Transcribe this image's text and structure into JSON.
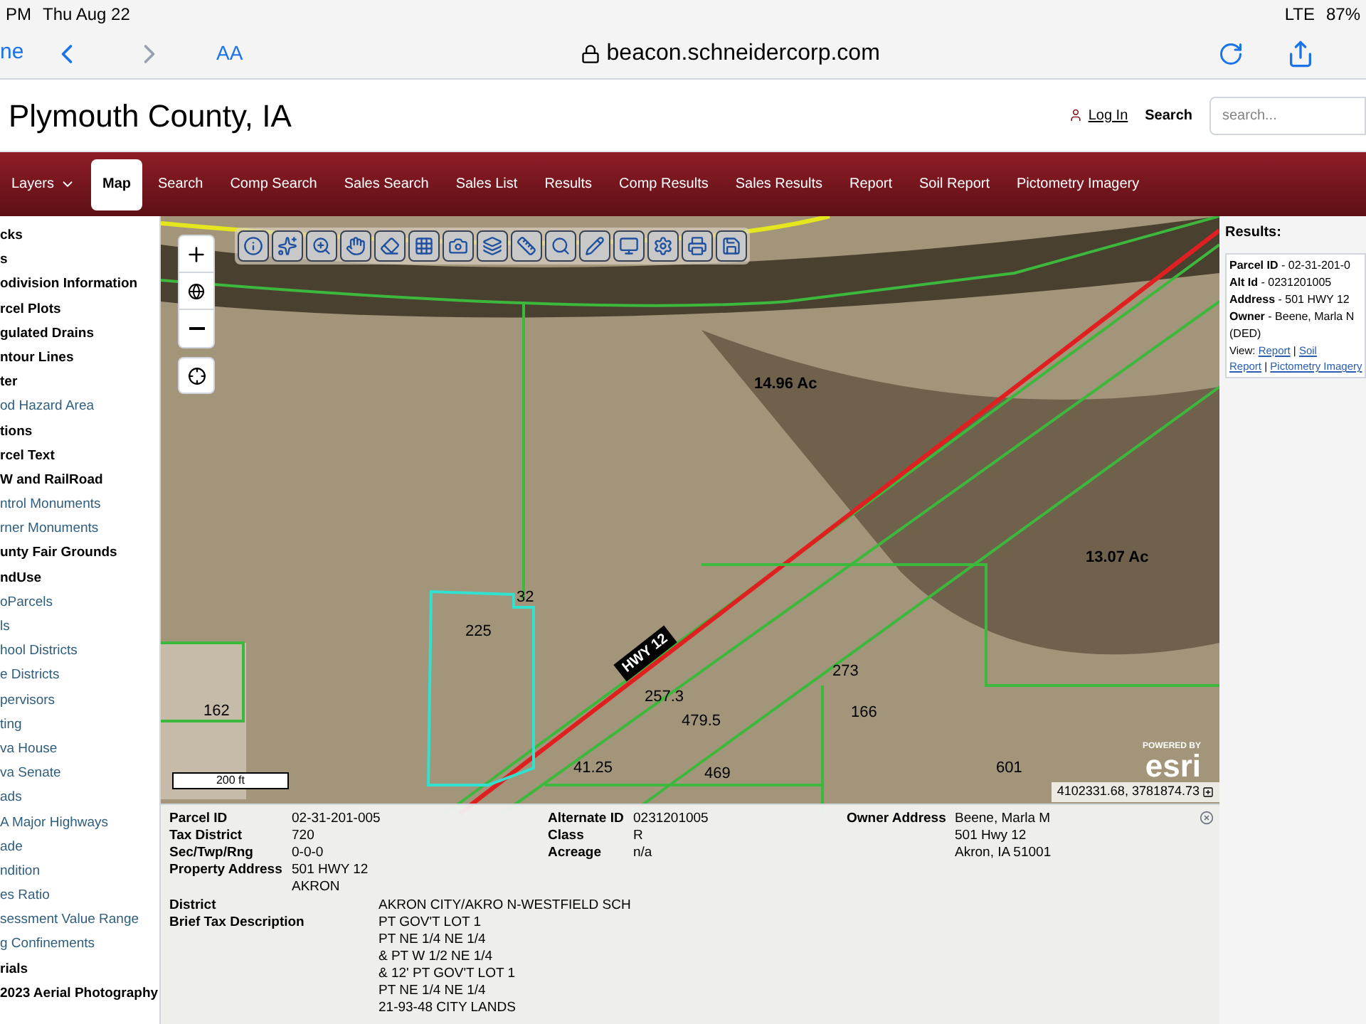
{
  "status_bar": {
    "time": "PM",
    "date": "Thu Aug 22",
    "network": "LTE",
    "battery": "87%"
  },
  "browser": {
    "done": "ne",
    "text_size": "AA",
    "url": "beacon.schneidercorp.com"
  },
  "header": {
    "title": "Plymouth County, IA",
    "login": "Log In",
    "search_label": "Search",
    "search_placeholder": "search..."
  },
  "nav": [
    {
      "label": "Layers",
      "selected": false,
      "dropdown": true
    },
    {
      "label": "Map",
      "selected": true
    },
    {
      "label": "Search",
      "selected": false
    },
    {
      "label": "Comp Search",
      "selected": false
    },
    {
      "label": "Sales Search",
      "selected": false
    },
    {
      "label": "Sales List",
      "selected": false
    },
    {
      "label": "Results",
      "selected": false
    },
    {
      "label": "Comp Results",
      "selected": false
    },
    {
      "label": "Sales Results",
      "selected": false
    },
    {
      "label": "Report",
      "selected": false
    },
    {
      "label": "Soil Report",
      "selected": false
    },
    {
      "label": "Pictometry Imagery",
      "selected": false
    }
  ],
  "layers": [
    {
      "label": "cks",
      "kind": "group"
    },
    {
      "label": "s",
      "kind": "group"
    },
    {
      "label": "odivision Information",
      "kind": "group"
    },
    {
      "label": "rcel Plots",
      "kind": "group"
    },
    {
      "label": "gulated Drains",
      "kind": "group"
    },
    {
      "label": "ntour Lines",
      "kind": "group"
    },
    {
      "label": "ter",
      "kind": "group"
    },
    {
      "label": "od Hazard Area",
      "kind": "layer"
    },
    {
      "label": "tions",
      "kind": "group"
    },
    {
      "label": "rcel Text",
      "kind": "group"
    },
    {
      "label": "W and RailRoad",
      "kind": "group"
    },
    {
      "label": "ntrol Monuments",
      "kind": "layer"
    },
    {
      "label": "rner Monuments",
      "kind": "layer"
    },
    {
      "label": "unty Fair Grounds",
      "kind": "group"
    },
    {
      "label": "ndUse",
      "kind": "group"
    },
    {
      "label": "oParcels",
      "kind": "layer"
    },
    {
      "label": "ls",
      "kind": "layer"
    },
    {
      "label": "hool Districts",
      "kind": "layer"
    },
    {
      "label": "e Districts",
      "kind": "layer"
    },
    {
      "label": "pervisors",
      "kind": "layer"
    },
    {
      "label": "ting",
      "kind": "layer"
    },
    {
      "label": "va House",
      "kind": "layer"
    },
    {
      "label": "va Senate",
      "kind": "layer"
    },
    {
      "label": "ads",
      "kind": "layer"
    },
    {
      "label": "A Major Highways",
      "kind": "layer"
    },
    {
      "label": "ade",
      "kind": "layer"
    },
    {
      "label": "ndition",
      "kind": "layer"
    },
    {
      "label": "es Ratio",
      "kind": "layer"
    },
    {
      "label": "sessment Value Range",
      "kind": "layer"
    },
    {
      "label": "g Confinements",
      "kind": "layer"
    },
    {
      "label": "rials",
      "kind": "group"
    },
    {
      "label": "2023 Aerial Photography",
      "kind": "group"
    }
  ],
  "map": {
    "labels": [
      {
        "text": "14.96 Ac",
        "kind": "area"
      },
      {
        "text": "13.07 Ac",
        "kind": "area"
      },
      {
        "text": "HWY 12",
        "kind": "road"
      },
      {
        "text": "32",
        "kind": "dim"
      },
      {
        "text": "225",
        "kind": "dim"
      },
      {
        "text": "162",
        "kind": "dim"
      },
      {
        "text": "273",
        "kind": "dim"
      },
      {
        "text": "257.3",
        "kind": "dim"
      },
      {
        "text": "166",
        "kind": "dim"
      },
      {
        "text": "479.5",
        "kind": "dim"
      },
      {
        "text": "41.25",
        "kind": "dim"
      },
      {
        "text": "469",
        "kind": "dim"
      },
      {
        "text": "601",
        "kind": "dim"
      }
    ],
    "scale": "200 ft",
    "esri_powered": "POWERED BY",
    "esri": "esri",
    "coordinates": "4102331.68, 3781874.73"
  },
  "results": {
    "title": "Results:",
    "fields": [
      {
        "label": "Parcel ID",
        "value": "02-31-201-0"
      },
      {
        "label": "Alt Id",
        "value": "0231201005"
      },
      {
        "label": "Address",
        "value": "501 HWY 12"
      },
      {
        "label": "Owner",
        "value": "Beene, Marla N"
      }
    ],
    "separator": "-",
    "link_separator": "|",
    "extra": "(DED)",
    "view": "View:",
    "links": [
      "Report",
      "Soil",
      "Report",
      "Pictometry Imagery"
    ]
  },
  "info": {
    "col1": [
      {
        "label": "Parcel ID",
        "value": [
          "02-31-201-005"
        ]
      },
      {
        "label": "Tax District",
        "value": [
          "720"
        ]
      },
      {
        "label": "Sec/Twp/Rng",
        "value": [
          "0-0-0"
        ]
      },
      {
        "label": "Property Address",
        "value": [
          "501 HWY 12",
          "AKRON"
        ]
      }
    ],
    "col2": [
      {
        "label": "Alternate ID",
        "value": [
          "0231201005"
        ]
      },
      {
        "label": "Class",
        "value": [
          "R"
        ]
      },
      {
        "label": "Acreage",
        "value": [
          "n/a"
        ]
      }
    ],
    "col3": [
      {
        "label": "Owner Address",
        "value": [
          "Beene, Marla M",
          "501 Hwy 12",
          "Akron, IA 51001"
        ]
      }
    ],
    "district_label": "District",
    "district": "AKRON CITY/AKRO N-WESTFIELD SCH",
    "brief_label": "Brief Tax Description",
    "brief": [
      "PT GOV'T LOT 1",
      "PT NE 1/4 NE 1/4",
      "& PT W 1/2 NE 1/4",
      "& 12' PT GOV'T LOT 1",
      "PT NE 1/4 NE 1/4",
      "21-93-48 CITY LANDS"
    ]
  }
}
